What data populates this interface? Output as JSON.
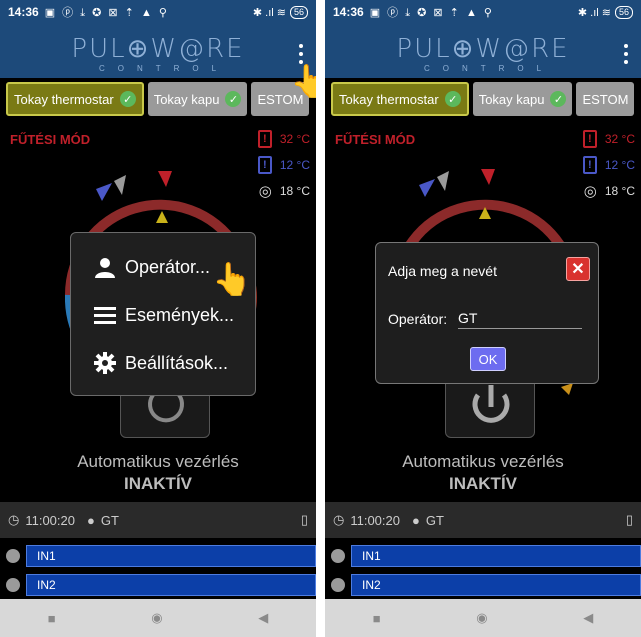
{
  "status_bar": {
    "time": "14:36",
    "icons": "▣ ⓟ ⤓ ✪ ⊠ ⇡ ▲ ⚲",
    "right": "✱ .ıl ≋",
    "battery": "56"
  },
  "app": {
    "logo": "PUL⊕W@RE",
    "logo_sub": "CONTROL"
  },
  "tabs": [
    {
      "label": "Tokay thermostar",
      "status": "ok",
      "active": true
    },
    {
      "label": "Tokay kapu",
      "status": "ok",
      "active": false
    },
    {
      "label": "ESTOM",
      "status": "",
      "active": false
    }
  ],
  "heating": {
    "mode_label": "FŰTÉSI MÓD",
    "max_temp": "32 °C",
    "min_temp": "12 °C",
    "current_temp": "18 °C"
  },
  "control": {
    "auto_label": "Automatikus vezérlés",
    "auto_state": "INAKTÍV"
  },
  "info": {
    "time": "11:00:20",
    "user": "GT"
  },
  "io": [
    {
      "label": "IN1"
    },
    {
      "label": "IN2"
    }
  ],
  "menu": {
    "items": [
      {
        "label": "Operátor...",
        "icon": "person-icon"
      },
      {
        "label": "Események...",
        "icon": "list-icon"
      },
      {
        "label": "Beállítások...",
        "icon": "gear-icon"
      }
    ]
  },
  "dialog": {
    "title": "Adja meg a nevét",
    "field_label": "Operátor:",
    "field_value": "GT",
    "ok_label": "OK"
  },
  "colors": {
    "appbar": "#1d4a7a",
    "accent_red": "#c0202a",
    "accent_blue": "#4a58c8",
    "io_bar": "#0c3fa8",
    "ok_check": "#5cb85c"
  }
}
